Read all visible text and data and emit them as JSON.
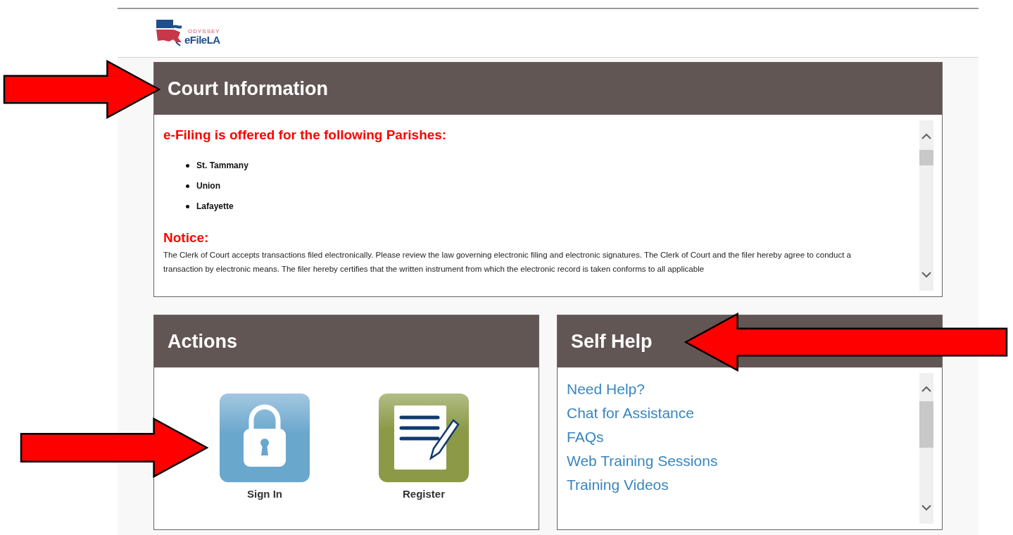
{
  "logo": {
    "overline": "ODYSSEY",
    "name": "eFileLA"
  },
  "court_information": {
    "title": "Court Information",
    "heading": "e-Filing is offered for the following Parishes:",
    "parishes": [
      "St. Tammany",
      "Union",
      "Lafayette"
    ],
    "notice_title": "Notice:",
    "notice_text": "The Clerk of Court accepts transactions filed electronically. Please review the law governing electronic filing and electronic signatures. The Clerk of Court and the filer hereby agree to conduct a transaction by electronic means. The filer hereby certifies that the written instrument from which the electronic record is taken conforms to all applicable"
  },
  "actions": {
    "title": "Actions",
    "items": [
      {
        "kind": "lock",
        "label": "Sign In"
      },
      {
        "kind": "document",
        "label": "Register"
      }
    ]
  },
  "self_help": {
    "title": "Self Help",
    "links": [
      "Need Help?",
      "Chat for Assistance",
      "FAQs",
      "Web Training Sessions",
      "Training Videos"
    ]
  }
}
